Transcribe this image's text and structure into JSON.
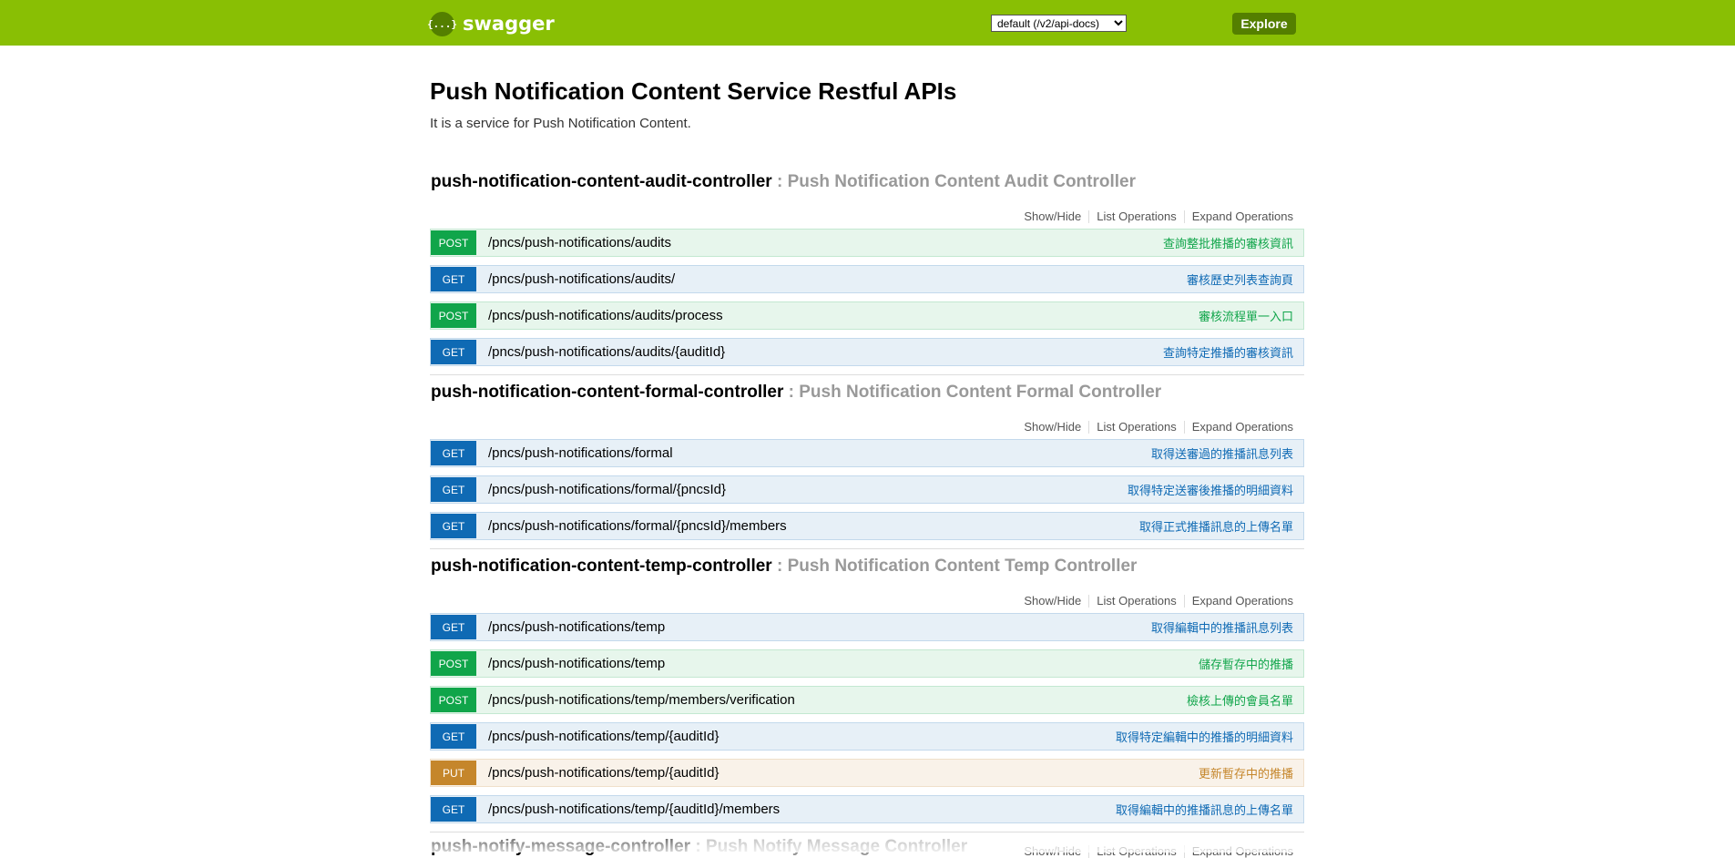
{
  "header": {
    "logo_glyph": "{...}",
    "logo_text": "swagger",
    "spec_select": {
      "selected": "default (/v2/api-docs)"
    },
    "explore_label": "Explore",
    "colors": {
      "bar": "#89bf04",
      "accent": "#547f00"
    }
  },
  "info": {
    "title": "Push Notification Content Service Restful APIs",
    "description": "It is a service for Push Notification Content."
  },
  "resource_links": {
    "show_hide": "Show/Hide",
    "list_operations": "List Operations",
    "expand_operations": "Expand Operations"
  },
  "method_colors": {
    "get": "#0f6ab4",
    "post": "#10a54a",
    "put": "#c5862b"
  },
  "resources": [
    {
      "name": "push-notification-content-audit-controller",
      "description": ": Push Notification Content Audit Controller",
      "operations": [
        {
          "method": "POST",
          "path": "/pncs/push-notifications/audits",
          "summary": "查詢整批推播的審核資訊"
        },
        {
          "method": "GET",
          "path": "/pncs/push-notifications/audits/",
          "summary": "審核歷史列表查詢頁"
        },
        {
          "method": "POST",
          "path": "/pncs/push-notifications/audits/process",
          "summary": "審核流程單一入口"
        },
        {
          "method": "GET",
          "path": "/pncs/push-notifications/audits/{auditId}",
          "summary": "查詢特定推播的審核資訊"
        }
      ]
    },
    {
      "name": "push-notification-content-formal-controller",
      "description": ": Push Notification Content Formal Controller",
      "operations": [
        {
          "method": "GET",
          "path": "/pncs/push-notifications/formal",
          "summary": "取得送審過的推播訊息列表"
        },
        {
          "method": "GET",
          "path": "/pncs/push-notifications/formal/{pncsId}",
          "summary": "取得特定送審後推播的明細資料"
        },
        {
          "method": "GET",
          "path": "/pncs/push-notifications/formal/{pncsId}/members",
          "summary": "取得正式推播訊息的上傳名單"
        }
      ]
    },
    {
      "name": "push-notification-content-temp-controller",
      "description": ": Push Notification Content Temp Controller",
      "operations": [
        {
          "method": "GET",
          "path": "/pncs/push-notifications/temp",
          "summary": "取得編輯中的推播訊息列表"
        },
        {
          "method": "POST",
          "path": "/pncs/push-notifications/temp",
          "summary": "儲存暫存中的推播"
        },
        {
          "method": "POST",
          "path": "/pncs/push-notifications/temp/members/verification",
          "summary": "檢核上傳的會員名單"
        },
        {
          "method": "GET",
          "path": "/pncs/push-notifications/temp/{auditId}",
          "summary": "取得特定編輯中的推播的明細資料"
        },
        {
          "method": "PUT",
          "path": "/pncs/push-notifications/temp/{auditId}",
          "summary": "更新暫存中的推播"
        },
        {
          "method": "GET",
          "path": "/pncs/push-notifications/temp/{auditId}/members",
          "summary": "取得編輯中的推播訊息的上傳名單"
        }
      ]
    },
    {
      "name": "push-notify-message-controller",
      "description": ": Push Notify Message Controller",
      "operations": []
    }
  ]
}
